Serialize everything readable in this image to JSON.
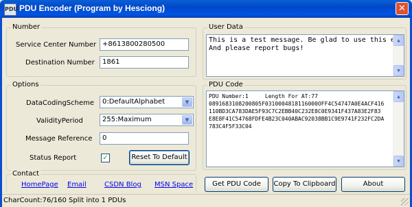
{
  "window": {
    "title": "PDU Encoder (Program by Hesciong)",
    "close_glyph": "✕",
    "icon": "PDU"
  },
  "number_group": {
    "legend": "Number",
    "service_center_label": "Service Center Number",
    "service_center_value": "+8613800280500",
    "destination_label": "Destination Number",
    "destination_value": "1861"
  },
  "options_group": {
    "legend": "Options",
    "coding_label": "DataCodingScheme",
    "coding_value": "0:DefaultAlphabet",
    "validity_label": "ValidityPeriod",
    "validity_value": "255:Maximum",
    "reference_label": "Message Reference",
    "reference_value": "0",
    "status_label": "Status Report",
    "status_checked": true,
    "reset_label": "Reset To Default"
  },
  "contact_group": {
    "legend": "Contact",
    "links": [
      "HomePage",
      "Email",
      "CSDN Blog",
      "MSN Space"
    ]
  },
  "user_data_group": {
    "legend": "User Data",
    "text_line1": "This is a test message. Be glad to use this encoder!",
    "text_line2": "And please report bugs!"
  },
  "pdu_group": {
    "legend": "PDU Code",
    "header": "PDU Number:1     Length For AT:77",
    "lines": [
      "0891683108200805F0310004818116000OFF4C54747A0E4ACF416",
      "110BD3CA783DAE5F93C7C2EBB40C232E8C0E9341F437A83E2F83",
      "E8E8F41C54768FDFE4B23C040ABAC92038BB1C9E9741F232FC2DA",
      "783C4F5F33C04"
    ]
  },
  "buttons": {
    "get_pdu": "Get PDU Code",
    "copy": "Copy To Clipboard",
    "about": "About"
  },
  "status": {
    "text": "CharCount:76/160  Split into 1 PDUs"
  },
  "icons": {
    "check": "✓",
    "dropdown": "▼",
    "scroll_up": "▲",
    "scroll_down": "▼"
  }
}
